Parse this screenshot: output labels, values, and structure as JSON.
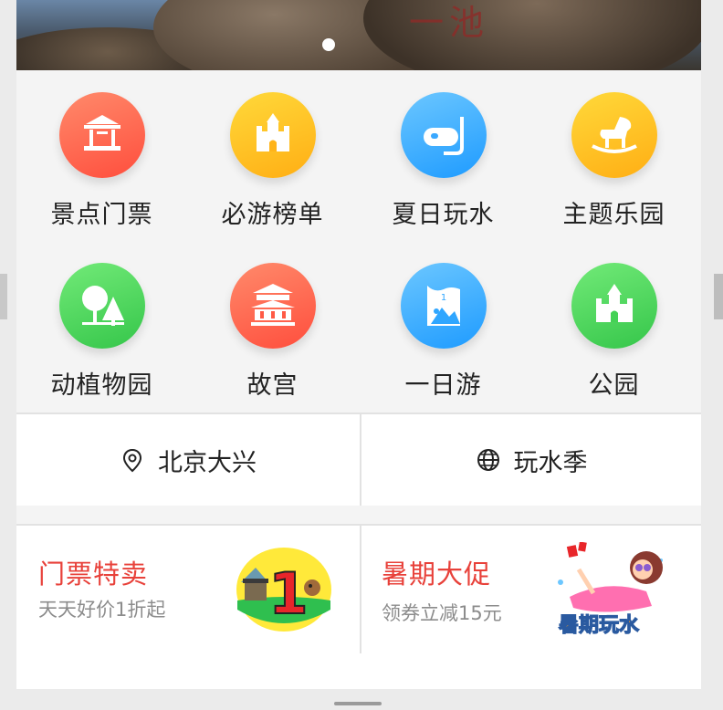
{
  "banner": {
    "carved_text": "一池",
    "page_indicator": 1
  },
  "categories": [
    {
      "label": "景点门票",
      "icon": "pavilion-icon",
      "color": "#ff5a45"
    },
    {
      "label": "必游榜单",
      "icon": "castle-icon",
      "color": "#ffc21c"
    },
    {
      "label": "夏日玩水",
      "icon": "diving-mask-icon",
      "color": "#2fa6ff"
    },
    {
      "label": "主题乐园",
      "icon": "rocking-horse-icon",
      "color": "#ffc21c"
    },
    {
      "label": "动植物园",
      "icon": "trees-icon",
      "color": "#45d156"
    },
    {
      "label": "故宫",
      "icon": "palace-icon",
      "color": "#ff5a45"
    },
    {
      "label": "一日游",
      "icon": "flag-mountain-icon",
      "color": "#2fa6ff"
    },
    {
      "label": "公园",
      "icon": "park-castle-icon",
      "color": "#45d156"
    }
  ],
  "location": {
    "left": {
      "label": "北京大兴",
      "icon": "location-pin-icon"
    },
    "right": {
      "label": "玩水季",
      "icon": "globe-icon"
    }
  },
  "promos": [
    {
      "title": "门票特卖",
      "subtitle": "天天好价1折起",
      "badge_text": "1"
    },
    {
      "title": "暑期大促",
      "subtitle": "领券立减15元",
      "badge_text": "暑期玩水"
    }
  ]
}
